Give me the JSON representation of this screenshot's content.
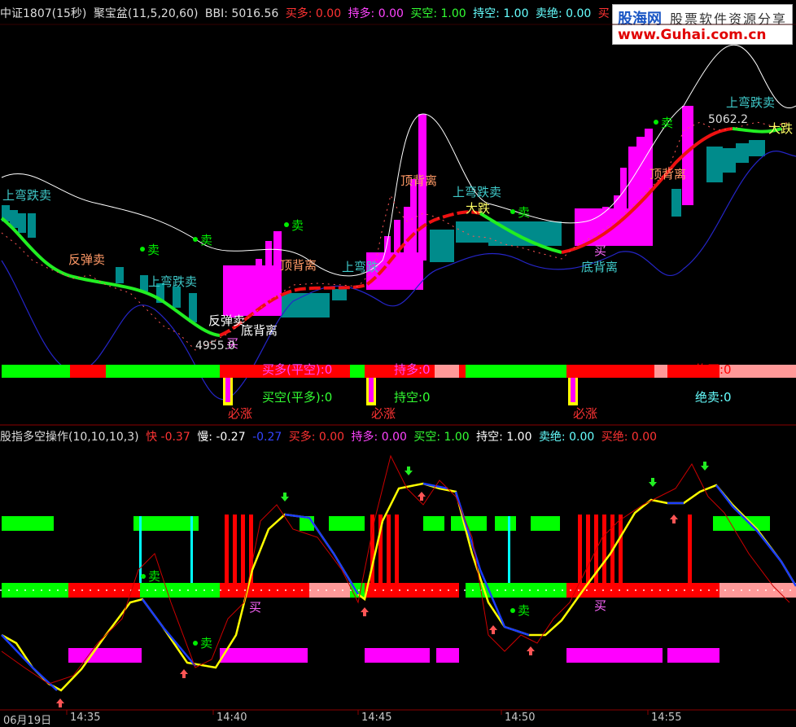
{
  "top_bar": {
    "title": "中证1807(15秒)",
    "indicator": "聚宝盆(11,5,20,60)",
    "bbi": "BBI: 5016.56",
    "buy_long": "买多: 0.00",
    "hold_long": "持多: 0.00",
    "buy_short": "买空: 1.00",
    "hold_short": "持空: 1.00",
    "sell_abs": "卖绝: 0.00",
    "buy_cut": "买"
  },
  "logo": {
    "name": "股海网",
    "slogan": "股票软件资源分享",
    "url": "www.Guhai.com.cn"
  },
  "main_chart": {
    "price_labels": {
      "low": "4955.0",
      "high": "5062.2"
    },
    "annotations": [
      {
        "text": "上弯跌卖",
        "color": "#3fc9c9"
      },
      {
        "text": "反弹卖",
        "color": "#ff9966"
      },
      {
        "text": "上弯跌卖",
        "color": "#3fc9c9"
      },
      {
        "text": "反弹卖",
        "color": "#ffffff"
      },
      {
        "text": "底背离",
        "color": "#ffffff"
      },
      {
        "text": "买",
        "color": "#ff66ff"
      },
      {
        "text": "顶背离",
        "color": "#ff9966"
      },
      {
        "text": "上弯跌",
        "color": "#3fc9c9"
      },
      {
        "text": "顶背离",
        "color": "#ff9966"
      },
      {
        "text": "上弯跌卖",
        "color": "#3fc9c9"
      },
      {
        "text": "大跌",
        "color": "#ffff66"
      },
      {
        "text": "买",
        "color": "#ff66ff"
      },
      {
        "text": "底背离",
        "color": "#3fc9c9"
      },
      {
        "text": "顶背离",
        "color": "#ff9966"
      },
      {
        "text": "上弯跌卖",
        "color": "#3fc9c9"
      },
      {
        "text": "大跌",
        "color": "#ffff66"
      }
    ],
    "sell_dots": [
      "卖",
      "卖",
      "卖",
      "卖",
      "卖"
    ]
  },
  "signal_band": {
    "buy_long_flat_short": "买多(平空):0",
    "hold_long": "持多:0",
    "abs_buy": "绝买:0",
    "buy_short_flat_long": "买空(平多):0",
    "hold_short": "持空:0",
    "abs_sell": "绝卖:0",
    "must_rise": [
      "必涨",
      "必涨",
      "必涨"
    ]
  },
  "bottom_bar": {
    "title": "股指多空操作(10,10,10,3)",
    "fast": "快 -0.37",
    "slow": "慢: -0.27",
    "third": "-0.27",
    "buy_long": "买多: 0.00",
    "hold_long": "持多: 0.00",
    "buy_short": "买空: 1.00",
    "hold_short": "持空: 1.00",
    "sell_abs": "卖绝: 0.00",
    "buy_abs": "买绝: 0.00"
  },
  "sub_chart": {
    "annotations": [
      "卖",
      "卖",
      "卖",
      "买",
      "买"
    ]
  },
  "time_axis": [
    "06月19日",
    "14:35",
    "14:40",
    "14:45",
    "14:50",
    "14:55"
  ],
  "colors": {
    "background": "#000000",
    "green": "#00ff00",
    "red": "#ff0000",
    "magenta": "#ff00ff",
    "teal": "#008b8b",
    "yellow": "#ffff00",
    "blue": "#1010ff",
    "pink": "#ff9999",
    "cyan": "#00ffff"
  }
}
